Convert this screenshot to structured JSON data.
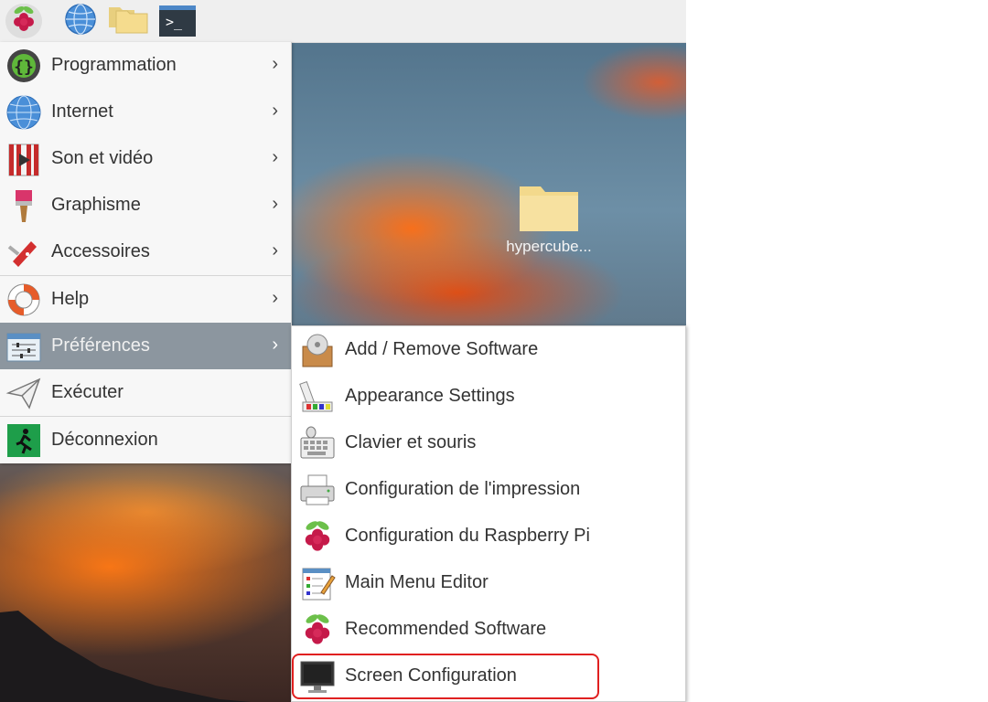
{
  "taskbar": {
    "items": [
      {
        "name": "raspberry-menu-button",
        "icon": "raspberry-icon"
      },
      {
        "name": "web-browser-button",
        "icon": "globe-icon"
      },
      {
        "name": "file-manager-button",
        "icon": "folder-icon"
      },
      {
        "name": "terminal-button",
        "icon": "terminal-icon"
      }
    ],
    "terminal_glyph": ">_"
  },
  "desktop": {
    "folder_label": "hypercube..."
  },
  "main_menu": {
    "items": [
      {
        "label": "Programmation",
        "icon": "programming-icon",
        "has_submenu": true
      },
      {
        "label": "Internet",
        "icon": "globe-icon",
        "has_submenu": true
      },
      {
        "label": "Son et vidéo",
        "icon": "video-icon",
        "has_submenu": true
      },
      {
        "label": "Graphisme",
        "icon": "paintbrush-icon",
        "has_submenu": true
      },
      {
        "label": "Accessoires",
        "icon": "swiss-knife-icon",
        "has_submenu": true
      },
      {
        "label": "Help",
        "icon": "lifebuoy-icon",
        "has_submenu": true
      },
      {
        "label": "Préférences",
        "icon": "preferences-icon",
        "has_submenu": true,
        "selected": true
      },
      {
        "label": "Exécuter",
        "icon": "paper-plane-icon",
        "has_submenu": false
      },
      {
        "label": "Déconnexion",
        "icon": "exit-icon",
        "has_submenu": false
      }
    ],
    "arrow": "›"
  },
  "sub_menu": {
    "items": [
      {
        "label": "Add / Remove Software",
        "icon": "package-icon"
      },
      {
        "label": "Appearance Settings",
        "icon": "palette-icon"
      },
      {
        "label": "Clavier et souris",
        "icon": "keyboard-mouse-icon"
      },
      {
        "label": "Configuration de l'impression",
        "icon": "printer-icon"
      },
      {
        "label": "Configuration du Raspberry Pi",
        "icon": "raspberry-icon"
      },
      {
        "label": "Main Menu Editor",
        "icon": "menu-editor-icon"
      },
      {
        "label": "Recommended Software",
        "icon": "raspberry-icon"
      },
      {
        "label": "Screen Configuration",
        "icon": "monitor-icon",
        "highlighted": true
      }
    ]
  },
  "colors": {
    "selected_bg": "#8c969f",
    "highlight_border": "#e02020",
    "raspberry_red": "#c51a4a",
    "leaf_green": "#6cc04a"
  }
}
